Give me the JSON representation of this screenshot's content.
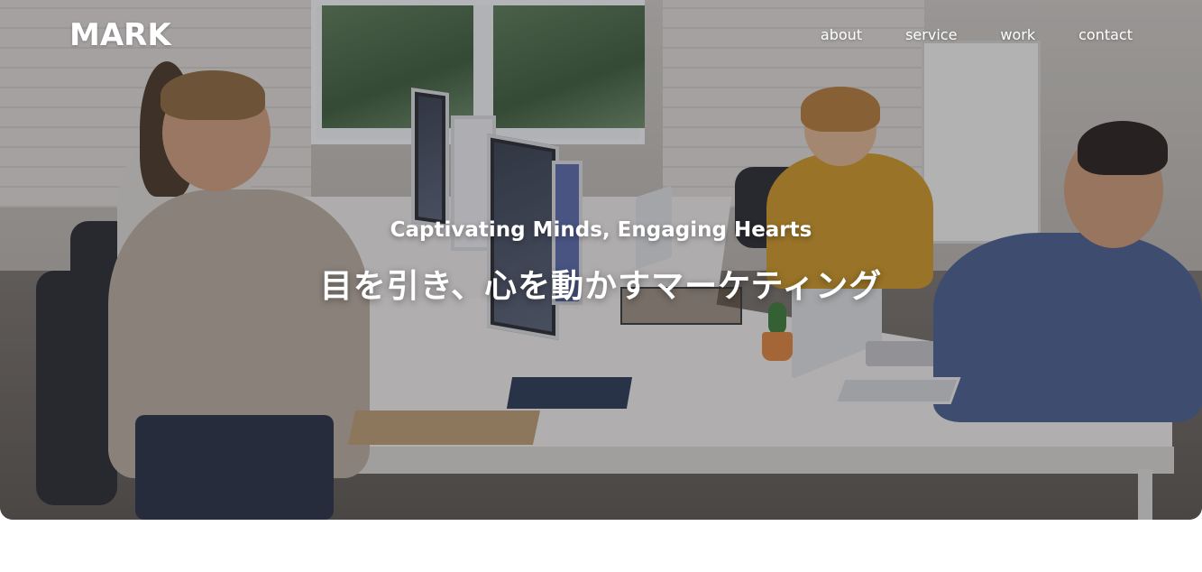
{
  "header": {
    "logo": "MARK",
    "nav": [
      {
        "label": "about"
      },
      {
        "label": "service"
      },
      {
        "label": "work"
      },
      {
        "label": "contact"
      }
    ]
  },
  "hero": {
    "tagline": "Captivating Minds, Engaging Hearts",
    "headline": "目を引き、心を動かすマーケティング",
    "image_description_icon": "office-team-photo"
  },
  "colors": {
    "text": "#ffffff",
    "page_background": "#ffffff"
  }
}
